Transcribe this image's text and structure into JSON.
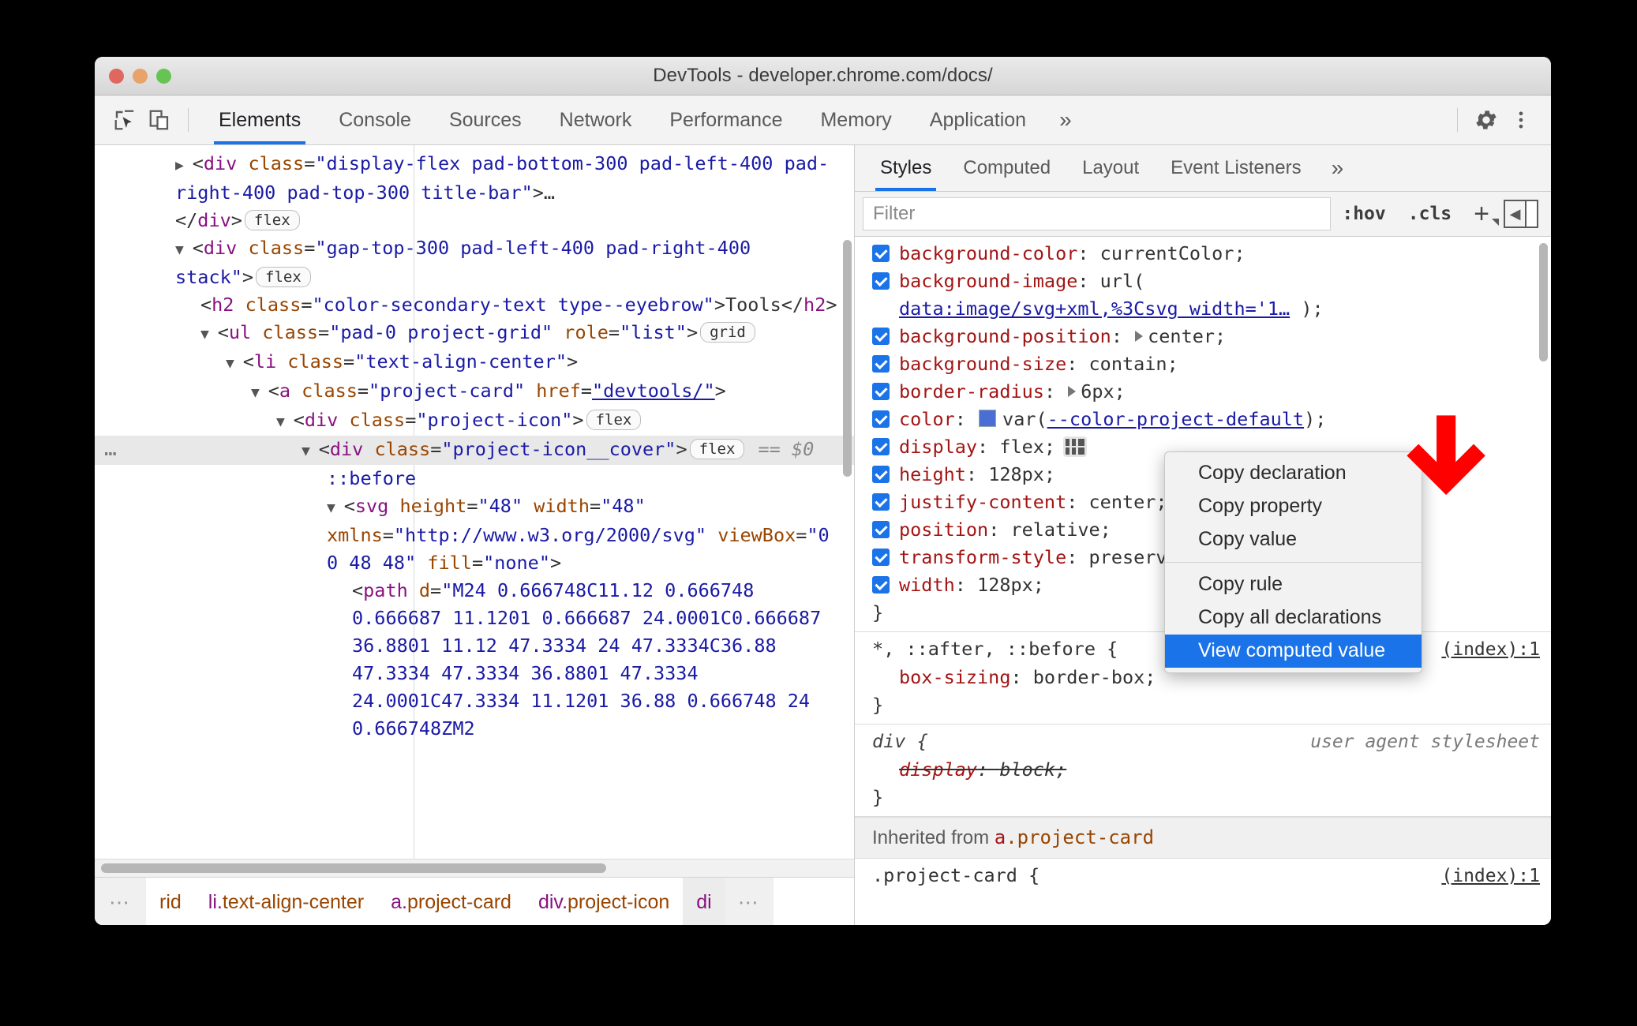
{
  "window": {
    "title": "DevTools - developer.chrome.com/docs/",
    "traffic_lights": [
      "close",
      "minimize",
      "maximize"
    ]
  },
  "toolbar": {
    "inspect_icon": "inspect-cursor-icon",
    "device_icon": "device-toolbar-icon",
    "tabs": [
      {
        "label": "Elements",
        "active": true
      },
      {
        "label": "Console",
        "active": false
      },
      {
        "label": "Sources",
        "active": false
      },
      {
        "label": "Network",
        "active": false
      },
      {
        "label": "Performance",
        "active": false
      },
      {
        "label": "Memory",
        "active": false
      },
      {
        "label": "Application",
        "active": false
      }
    ],
    "more_tabs": "»",
    "settings_icon": "gear-icon",
    "menu_icon": "kebab-menu-icon"
  },
  "dom_tree": {
    "rows": [
      {
        "indent": 1,
        "tri": "▶",
        "parts": [
          {
            "t": "pun",
            "v": "<"
          },
          {
            "t": "tg",
            "v": "div"
          },
          {
            "t": "at",
            "v": " class"
          },
          {
            "t": "pun",
            "v": "="
          },
          {
            "t": "av",
            "v": "\"display-flex pad-bottom-300 pad-left-400 pad-right-400 pad-top-300 title-bar\""
          },
          {
            "t": "pun",
            "v": ">"
          },
          {
            "t": "txt",
            "v": "…"
          }
        ]
      },
      {
        "indent": 1,
        "parts": [
          {
            "t": "pun",
            "v": "</"
          },
          {
            "t": "tg",
            "v": "div"
          },
          {
            "t": "pun",
            "v": ">"
          }
        ],
        "chip": "flex"
      },
      {
        "indent": 1,
        "tri": "▼",
        "parts": [
          {
            "t": "pun",
            "v": "<"
          },
          {
            "t": "tg",
            "v": "div"
          },
          {
            "t": "at",
            "v": " class"
          },
          {
            "t": "pun",
            "v": "="
          },
          {
            "t": "av",
            "v": "\"gap-top-300 pad-left-400 pad-right-400 stack\""
          },
          {
            "t": "pun",
            "v": ">"
          }
        ],
        "chip": "flex"
      },
      {
        "indent": 2,
        "parts": [
          {
            "t": "pun",
            "v": "<"
          },
          {
            "t": "tg",
            "v": "h2"
          },
          {
            "t": "at",
            "v": " class"
          },
          {
            "t": "pun",
            "v": "="
          },
          {
            "t": "av",
            "v": "\"color-secondary-text type--eyebrow\""
          },
          {
            "t": "pun",
            "v": ">"
          },
          {
            "t": "txt",
            "v": "Tools"
          },
          {
            "t": "pun",
            "v": "</"
          },
          {
            "t": "tg",
            "v": "h2"
          },
          {
            "t": "pun",
            "v": ">"
          }
        ]
      },
      {
        "indent": 2,
        "tri": "▼",
        "parts": [
          {
            "t": "pun",
            "v": "<"
          },
          {
            "t": "tg",
            "v": "ul"
          },
          {
            "t": "at",
            "v": " class"
          },
          {
            "t": "pun",
            "v": "="
          },
          {
            "t": "av",
            "v": "\"pad-0 project-grid\""
          },
          {
            "t": "at",
            "v": " role"
          },
          {
            "t": "pun",
            "v": "="
          },
          {
            "t": "av",
            "v": "\"list\""
          },
          {
            "t": "pun",
            "v": ">"
          }
        ],
        "chip": "grid"
      },
      {
        "indent": 3,
        "tri": "▼",
        "parts": [
          {
            "t": "pun",
            "v": "<"
          },
          {
            "t": "tg",
            "v": "li"
          },
          {
            "t": "at",
            "v": " class"
          },
          {
            "t": "pun",
            "v": "="
          },
          {
            "t": "av",
            "v": "\"text-align-center\""
          },
          {
            "t": "pun",
            "v": ">"
          }
        ]
      },
      {
        "indent": 4,
        "tri": "▼",
        "parts": [
          {
            "t": "pun",
            "v": "<"
          },
          {
            "t": "tg",
            "v": "a"
          },
          {
            "t": "at",
            "v": " class"
          },
          {
            "t": "pun",
            "v": "="
          },
          {
            "t": "av",
            "v": "\"project-card\""
          },
          {
            "t": "at",
            "v": " href"
          },
          {
            "t": "pun",
            "v": "="
          },
          {
            "t": "link",
            "v": "\"devtools/\""
          },
          {
            "t": "pun",
            "v": ">"
          }
        ]
      },
      {
        "indent": 5,
        "tri": "▼",
        "parts": [
          {
            "t": "pun",
            "v": "<"
          },
          {
            "t": "tg",
            "v": "div"
          },
          {
            "t": "at",
            "v": " class"
          },
          {
            "t": "pun",
            "v": "="
          },
          {
            "t": "av",
            "v": "\"project-icon\""
          },
          {
            "t": "pun",
            "v": ">"
          }
        ],
        "chip": "flex"
      },
      {
        "indent": 6,
        "tri": "▼",
        "selected": true,
        "badge": "⋯",
        "parts": [
          {
            "t": "pun",
            "v": "<"
          },
          {
            "t": "tg",
            "v": "div"
          },
          {
            "t": "at",
            "v": " class"
          },
          {
            "t": "pun",
            "v": "="
          },
          {
            "t": "av",
            "v": "\"project-icon__cover\""
          },
          {
            "t": "pun",
            "v": ">"
          }
        ],
        "chip": "flex",
        "suffix_eq": "==",
        "suffix_dollar": "$0"
      },
      {
        "indent": 7,
        "parts": [
          {
            "t": "pseudo",
            "v": "::before"
          }
        ]
      },
      {
        "indent": 7,
        "tri": "▼",
        "parts": [
          {
            "t": "pun",
            "v": "<"
          },
          {
            "t": "tg",
            "v": "svg"
          },
          {
            "t": "at",
            "v": " height"
          },
          {
            "t": "pun",
            "v": "="
          },
          {
            "t": "av",
            "v": "\"48\""
          },
          {
            "t": "at",
            "v": " width"
          },
          {
            "t": "pun",
            "v": "="
          },
          {
            "t": "av",
            "v": "\"48\""
          },
          {
            "t": "at",
            "v": " xmlns"
          },
          {
            "t": "pun",
            "v": "="
          },
          {
            "t": "av",
            "v": "\"http://www.w3.org/2000/svg\""
          },
          {
            "t": "at",
            "v": " viewBox"
          },
          {
            "t": "pun",
            "v": "="
          },
          {
            "t": "av",
            "v": "\"0 0 48 48\""
          },
          {
            "t": "at",
            "v": " fill"
          },
          {
            "t": "pun",
            "v": "="
          },
          {
            "t": "av",
            "v": "\"none\""
          },
          {
            "t": "pun",
            "v": ">"
          }
        ]
      },
      {
        "indent": 8,
        "parts": [
          {
            "t": "pun",
            "v": "<"
          },
          {
            "t": "tg",
            "v": "path"
          },
          {
            "t": "at",
            "v": " d"
          },
          {
            "t": "pun",
            "v": "="
          },
          {
            "t": "av",
            "v": "\"M24 0.666748C11.12 0.666748 0.666687 11.1201 0.666687 24.0001C0.666687 36.8801 11.12 47.3334 24 47.3334C36.88 47.3334 47.3334 36.8801 47.3334 24.0001C47.3334 11.1201 36.88 0.666748 24 0.666748ZM2"
          }
        ]
      }
    ]
  },
  "breadcrumb": {
    "leading_dots": "⋯",
    "items": [
      {
        "label": "rid",
        "tag": "",
        "selected": false
      },
      {
        "label": "text-align-center",
        "tag": "li.",
        "selected": false
      },
      {
        "label": "project-card",
        "tag": "a.",
        "selected": false
      },
      {
        "label": "project-icon",
        "tag": "div.",
        "selected": false
      },
      {
        "label": "",
        "tag": "di",
        "selected": true
      }
    ],
    "trailing_dots": "⋯"
  },
  "styles_pane": {
    "tabs": [
      {
        "label": "Styles",
        "active": true
      },
      {
        "label": "Computed",
        "active": false
      },
      {
        "label": "Layout",
        "active": false
      },
      {
        "label": "Event Listeners",
        "active": false
      }
    ],
    "more_tabs": "»",
    "filter_placeholder": "Filter",
    "filter_value": "",
    "hov_button": ":hov",
    "cls_button": ".cls",
    "new_rule_button": "+",
    "sidebar_toggle_icon": "sidebar-toggle-icon",
    "rules": [
      {
        "selector": "",
        "source": "",
        "declarations": [
          {
            "checked": true,
            "prop": "background-color",
            "value": "currentColor",
            "sep": ": "
          },
          {
            "checked": true,
            "prop": "background-image",
            "value": "url(",
            "sep": ": ",
            "link": "data:image/svg+xml,%3Csvg width='1…",
            "link_suffix": " );"
          },
          {
            "checked": true,
            "prop": "background-position",
            "value": "center",
            "sep": ": ",
            "expand": true
          },
          {
            "checked": true,
            "prop": "background-size",
            "value": "contain",
            "sep": ": "
          },
          {
            "checked": true,
            "prop": "border-radius",
            "value": "6px",
            "sep": ": ",
            "expand": true
          },
          {
            "checked": true,
            "prop": "color",
            "value": "var(--color-project-default);",
            "sep": ": ",
            "swatch": "#4a6fd4",
            "var_name": "--color-project-default"
          },
          {
            "checked": true,
            "prop": "display",
            "value": "flex",
            "sep": ": ",
            "flex_badge": true
          },
          {
            "checked": true,
            "prop": "height",
            "value": "128px",
            "sep": ": "
          },
          {
            "checked": true,
            "prop": "justify-content",
            "value": "center",
            "sep": ": "
          },
          {
            "checked": true,
            "prop": "position",
            "value": "relative",
            "sep": ": "
          },
          {
            "checked": true,
            "prop": "transform-style",
            "value": "preserve-3d",
            "sep": ": "
          },
          {
            "checked": true,
            "prop": "width",
            "value": "128px",
            "sep": ": "
          }
        ],
        "close_brace": "}"
      },
      {
        "selector": "*, ::after, ::before {",
        "source": "(index):1",
        "declarations": [
          {
            "checked": false,
            "prop": "box-sizing",
            "value": "border-box;",
            "sep": ": "
          }
        ],
        "close_brace": "}"
      },
      {
        "selector": "div {",
        "source": "user agent stylesheet",
        "italic": true,
        "declarations": [
          {
            "checked": false,
            "prop": "display",
            "value": "block;",
            "sep": ": ",
            "strike": true
          }
        ],
        "close_brace": "}"
      }
    ],
    "inherited_label": "Inherited from",
    "inherited_selector_tag": "a",
    "inherited_selector_class": ".project-card",
    "inherited_rule": {
      "selector": ".project-card {",
      "source": "(index):1"
    }
  },
  "context_menu": {
    "items": [
      {
        "label": "Copy declaration",
        "highlighted": false
      },
      {
        "label": "Copy property",
        "highlighted": false
      },
      {
        "label": "Copy value",
        "highlighted": false
      },
      {
        "separator": true
      },
      {
        "label": "Copy rule",
        "highlighted": false
      },
      {
        "label": "Copy all declarations",
        "highlighted": false
      },
      {
        "label": "View computed value",
        "highlighted": true
      }
    ]
  },
  "annotation": {
    "arrow_color": "#ff0000",
    "arrow_name": "red-callout-arrow"
  }
}
